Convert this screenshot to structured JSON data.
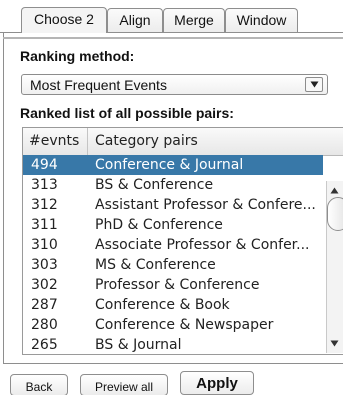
{
  "tabs": [
    {
      "label": "Choose 2",
      "active": true
    },
    {
      "label": "Align",
      "active": false
    },
    {
      "label": "Merge",
      "active": false
    },
    {
      "label": "Window",
      "active": false
    }
  ],
  "ranking": {
    "label": "Ranking method:",
    "selected": "Most Frequent Events"
  },
  "ranked_list": {
    "label": "Ranked list of all possible pairs:",
    "columns": [
      "#evnts",
      "Category pairs"
    ],
    "selected_index": 0,
    "rows": [
      {
        "count": "494",
        "pair": "Conference & Journal"
      },
      {
        "count": "313",
        "pair": "BS & Conference"
      },
      {
        "count": "312",
        "pair": "Assistant Professor & Confere..."
      },
      {
        "count": "311",
        "pair": "PhD & Conference"
      },
      {
        "count": "310",
        "pair": "Associate Professor & Confer..."
      },
      {
        "count": "303",
        "pair": "MS & Conference"
      },
      {
        "count": "302",
        "pair": "Professor & Conference"
      },
      {
        "count": "287",
        "pair": "Conference & Book"
      },
      {
        "count": "280",
        "pair": "Conference & Newspaper"
      },
      {
        "count": "265",
        "pair": "BS & Journal"
      }
    ]
  },
  "buttons": {
    "back": "Back",
    "preview_all": "Preview all",
    "apply": "Apply"
  },
  "icons": {
    "dropdown": "chevron-down-icon",
    "scroll_up": "arrow-up-icon",
    "scroll_down": "arrow-down-icon"
  },
  "colors": {
    "selection": "#3878a8",
    "selection_text": "#ffffff"
  }
}
